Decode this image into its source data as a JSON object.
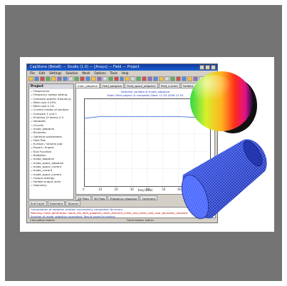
{
  "window": {
    "title": "CapStone (Beta6) — Studio (1.0) — [Ansys] — Field — Project",
    "menu": [
      "File",
      "Edit",
      "Settings",
      "Solution",
      "Mesh",
      "Options",
      "Tools",
      "Help"
    ]
  },
  "project_panel": {
    "header": "Project",
    "tree": [
      "Frequencies",
      "Frequency sweep setting",
      "Compute specific frequency",
      "Mesh size 0.05%",
      "Mesh size 0.1%",
      "Current modes of solution",
      "Compute 1 unit 1",
      "Primitive (0 items) 0 0",
      "Variables",
      "Circuits",
      "mode_adaptive",
      "Elements",
      "Optimize parameters",
      "Field Plot",
      "Surface / Volume plot",
      "Export / Import",
      "Eval Function",
      "Radiation",
      "mode_adaptive",
      "mode_space_adaptive",
      "mode_space_current",
      "mode_current",
      "mode_space_current",
      "Output settings",
      "Farfield output units",
      "Geometry"
    ],
    "bottom_tabs": [
      "Surf Layer",
      "Geometry",
      "Domain"
    ]
  },
  "doc_tabs": [
    "main_adaptive",
    "Field_adaptive",
    "Field_space_adaptive",
    "Field_current",
    "Farfield_current",
    "Field_space_current"
  ],
  "plot": {
    "title_line1": "Selected variable of mode_adaptive",
    "title_line2": "Data: Field project (0 complete) Date: 12.03.2006 12:53",
    "xlabel": "freq (GHz)",
    "xticks": [
      "0",
      "10",
      "20",
      "30",
      "40",
      "50",
      "60",
      "70",
      "80"
    ]
  },
  "plot_tabs": [
    "2D Plots",
    "3D Plots",
    "Frequency response",
    "Comment"
  ],
  "messages": {
    "tabs": [
      "Errors",
      "Warnings",
      "Information"
    ],
    "line1": "Computation of adaptive solution successfully completed. No errors.",
    "line2": "Warning: mesh generation: some_file_field_adaptive_mesh_element_limits_and_mesh_size_near_boundary_reached",
    "line3": "Solution of mode_adaptive completed. Result saved to project."
  },
  "status": {
    "left": "Calculation status:",
    "right": "Optimization status:"
  },
  "chart_data": {
    "type": "line",
    "x": [
      0,
      10,
      20,
      30,
      40,
      50,
      60,
      70,
      80
    ],
    "series": [
      {
        "values": [
          0.78,
          0.8,
          0.8,
          0.8,
          0.8,
          0.8,
          0.8,
          0.79,
          0.79
        ]
      }
    ],
    "ylim": [
      0,
      1
    ],
    "xlim": [
      0,
      80
    ],
    "grid": true,
    "colors": {
      "line": "#5b82d6",
      "grid": "#b9c6e8"
    }
  },
  "icons": {
    "sphere": "radiation-pattern-sphere-icon",
    "cone": "wireframe-cone-icon"
  },
  "colors": {
    "frame": "#747474",
    "titlebar": "#1c5fd1",
    "cone_fill": "#2b49d9"
  }
}
